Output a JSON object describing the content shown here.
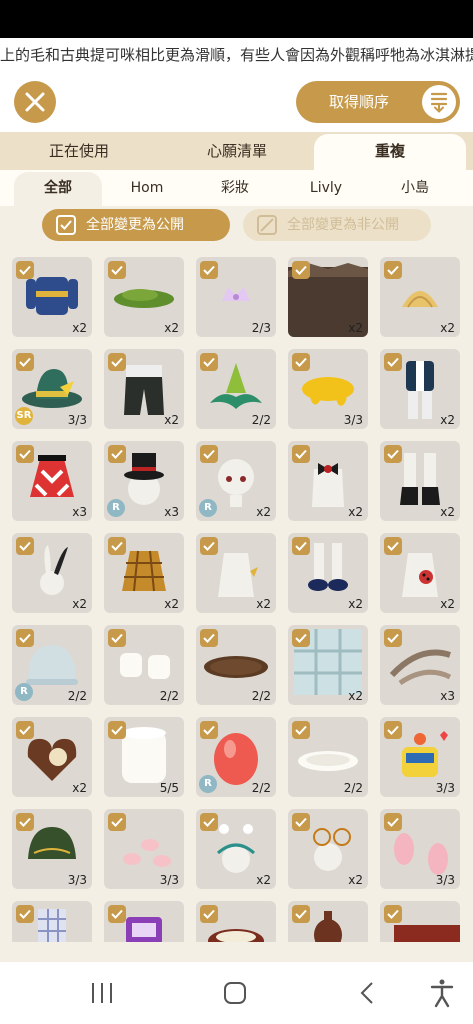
{
  "marquee": {
    "text": "上的毛和古典提可咪相比更為滑順，有些人會因為外觀稱呼牠為冰淇淋提"
  },
  "header": {
    "close_icon": "close-icon",
    "order_label": "取得順序",
    "sort_icon": "sort-icon"
  },
  "tabs": [
    {
      "label": "正在使用",
      "active": false
    },
    {
      "label": "心願清單",
      "active": false
    },
    {
      "label": "重複",
      "active": true
    }
  ],
  "subtabs": [
    {
      "label": "全部",
      "active": true
    },
    {
      "label": "Hom",
      "active": false
    },
    {
      "label": "彩妝",
      "active": false
    },
    {
      "label": "Livly",
      "active": false
    },
    {
      "label": "小島",
      "active": false
    }
  ],
  "toggles": {
    "public_label": "全部變更為公開",
    "private_label": "全部變更為非公開"
  },
  "colors": {
    "accent": "#c79a4b",
    "tab_bg": "#ece1c8",
    "page_bg": "#f4efe4",
    "cell_bg": "#ddd9d2"
  },
  "items": [
    {
      "icon": "sweater",
      "count": "x2",
      "badge": ""
    },
    {
      "icon": "moss",
      "count": "x2",
      "badge": ""
    },
    {
      "icon": "crown",
      "count": "2/3",
      "badge": ""
    },
    {
      "icon": "dark-wall",
      "count": "x2",
      "badge": ""
    },
    {
      "icon": "shell",
      "count": "x2",
      "badge": ""
    },
    {
      "icon": "green-hat",
      "count": "3/3",
      "badge": "SR"
    },
    {
      "icon": "black-pants",
      "count": "x2",
      "badge": ""
    },
    {
      "icon": "green-flower-hat",
      "count": "2/2",
      "badge": ""
    },
    {
      "icon": "yellow-splash",
      "count": "3/3",
      "badge": ""
    },
    {
      "icon": "uniform",
      "count": "x2",
      "badge": ""
    },
    {
      "icon": "checker-dress",
      "count": "x3",
      "badge": ""
    },
    {
      "icon": "top-hat",
      "count": "x3",
      "badge": "R"
    },
    {
      "icon": "doll-face",
      "count": "x2",
      "badge": "R"
    },
    {
      "icon": "bow-vest",
      "count": "x2",
      "badge": ""
    },
    {
      "icon": "black-boots",
      "count": "x2",
      "badge": ""
    },
    {
      "icon": "bunny-ears",
      "count": "x2",
      "badge": ""
    },
    {
      "icon": "plaid-skirt",
      "count": "x2",
      "badge": ""
    },
    {
      "icon": "white-top",
      "count": "x2",
      "badge": ""
    },
    {
      "icon": "navy-shoes",
      "count": "x2",
      "badge": ""
    },
    {
      "icon": "ladybug-top",
      "count": "x2",
      "badge": ""
    },
    {
      "icon": "glass-dome",
      "count": "2/2",
      "badge": "R"
    },
    {
      "icon": "marshmallows",
      "count": "2/2",
      "badge": ""
    },
    {
      "icon": "round-rug",
      "count": "2/2",
      "badge": ""
    },
    {
      "icon": "window",
      "count": "x2",
      "badge": ""
    },
    {
      "icon": "feathers",
      "count": "x3",
      "badge": ""
    },
    {
      "icon": "heart-cookie",
      "count": "x2",
      "badge": ""
    },
    {
      "icon": "white-cylinder",
      "count": "5/5",
      "badge": ""
    },
    {
      "icon": "red-egg",
      "count": "2/2",
      "badge": "R"
    },
    {
      "icon": "white-plate",
      "count": "2/2",
      "badge": ""
    },
    {
      "icon": "alarm-jar",
      "count": "3/3",
      "badge": ""
    },
    {
      "icon": "green-cap",
      "count": "3/3",
      "badge": ""
    },
    {
      "icon": "pink-petals",
      "count": "3/3",
      "badge": ""
    },
    {
      "icon": "flower-headband",
      "count": "x2",
      "badge": ""
    },
    {
      "icon": "round-glasses",
      "count": "x2",
      "badge": ""
    },
    {
      "icon": "pink-leaves",
      "count": "3/3",
      "badge": ""
    },
    {
      "icon": "plaid-sock",
      "count": "",
      "badge": ""
    },
    {
      "icon": "purple-gadget",
      "count": "",
      "badge": ""
    },
    {
      "icon": "bowl",
      "count": "",
      "badge": ""
    },
    {
      "icon": "vase",
      "count": "",
      "badge": ""
    },
    {
      "icon": "red-block",
      "count": "",
      "badge": ""
    }
  ],
  "badge_colors": {
    "SR": "#e0b33c",
    "R": "#8fb7c4"
  },
  "navbar": {
    "recent_icon": "recent-apps-icon",
    "home_icon": "home-icon",
    "back_icon": "back-icon",
    "accessibility_icon": "accessibility-icon"
  }
}
